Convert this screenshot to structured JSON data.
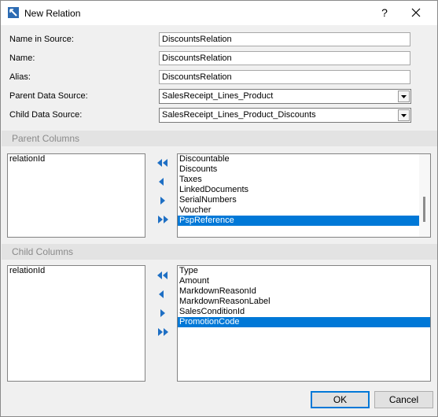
{
  "window": {
    "title": "New Relation",
    "help": "?",
    "close_icon": "close-icon"
  },
  "colors": {
    "accent": "#0078d7",
    "arrow": "#1e6fc4",
    "section_bg": "#e3e3e3",
    "section_text": "#8a8a8a"
  },
  "form": {
    "name_in_source": {
      "label": "Name in Source:",
      "value": "DiscountsRelation"
    },
    "name": {
      "label": "Name:",
      "value": "DiscountsRelation"
    },
    "alias": {
      "label": "Alias:",
      "value": "DiscountsRelation"
    },
    "parent_source": {
      "label": "Parent Data Source:",
      "value": "SalesReceipt_Lines_Product"
    },
    "child_source": {
      "label": "Child Data Source:",
      "value": "SalesReceipt_Lines_Product_Discounts"
    }
  },
  "parent_columns": {
    "header": "Parent Columns",
    "selected": [
      "relationId"
    ],
    "available": [
      {
        "label": "Discountable",
        "selected": false
      },
      {
        "label": "Discounts",
        "selected": false
      },
      {
        "label": "Taxes",
        "selected": false
      },
      {
        "label": "LinkedDocuments",
        "selected": false
      },
      {
        "label": "SerialNumbers",
        "selected": false
      },
      {
        "label": "Voucher",
        "selected": false
      },
      {
        "label": "PspReference",
        "selected": true
      }
    ]
  },
  "child_columns": {
    "header": "Child Columns",
    "selected": [
      "relationId"
    ],
    "available": [
      {
        "label": "Type",
        "selected": false
      },
      {
        "label": "Amount",
        "selected": false
      },
      {
        "label": "MarkdownReasonId",
        "selected": false
      },
      {
        "label": "MarkdownReasonLabel",
        "selected": false
      },
      {
        "label": "SalesConditionId",
        "selected": false
      },
      {
        "label": "PromotionCode",
        "selected": true
      }
    ]
  },
  "buttons": {
    "ok": "OK",
    "cancel": "Cancel"
  }
}
